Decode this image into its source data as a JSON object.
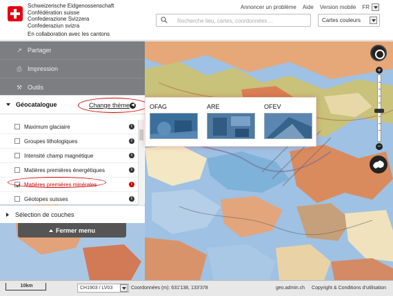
{
  "header": {
    "confederation_names": [
      "Schweizerische Eidgenossenschaft",
      "Confédération suisse",
      "Confederazione Svizzera",
      "Confederaziun svizra"
    ],
    "collaboration": "En collaboration avec les cantons",
    "links": {
      "report": "Annoncer un problème",
      "help": "Aide",
      "mobile": "Version mobile"
    },
    "language": "FR",
    "search_placeholder": "Recherche lieu, cartes, coordonnées ...",
    "background_map": "Cartes couleurs"
  },
  "menu": {
    "share": "Partager",
    "print": "Impression",
    "tools": "Outils",
    "catalog_title": "Géocatalogue",
    "change_theme": "Change thème",
    "layers": [
      {
        "label": "Maximum glaciaire",
        "checked": false
      },
      {
        "label": "Groupes lithologiques",
        "checked": false
      },
      {
        "label": "Intensité champ magnétique",
        "checked": false
      },
      {
        "label": "Matières premières énergétiques",
        "checked": false
      },
      {
        "label": "Matières premières minérales",
        "checked": true
      },
      {
        "label": "Géotopes suisses",
        "checked": false
      }
    ],
    "layer_selection": "Sélection de couches",
    "close_menu": "Fermer menu"
  },
  "themes": [
    {
      "label": "OFAG"
    },
    {
      "label": "ARE"
    },
    {
      "label": "OFEV"
    }
  ],
  "footer": {
    "scale": "10km",
    "crs": "CH1903 / LV03",
    "coordinates": "Coordonnées (m): 631'138, 133'378",
    "site": "geo.admin.ch",
    "legal": "Copyright & Conditions d'utilisation"
  },
  "colors": {
    "accent_red": "#cc0000",
    "menu_grey": "#787878",
    "map_blue": "#9fc1e3",
    "map_orange": "#d99a6c",
    "map_cream": "#f3e7c4"
  }
}
